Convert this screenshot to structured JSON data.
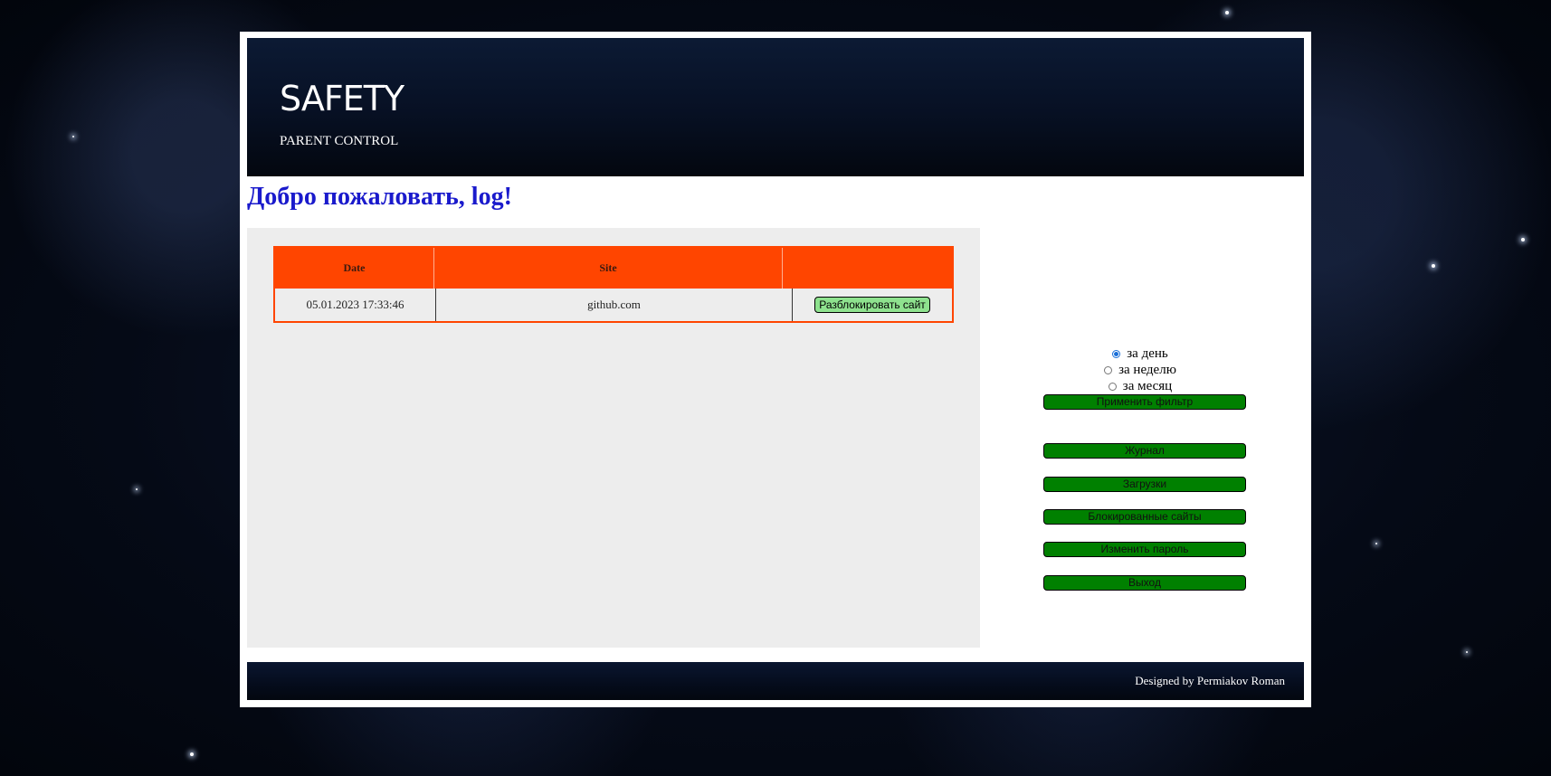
{
  "header": {
    "title": "SAFETY",
    "subtitle": "PARENT CONTROL"
  },
  "welcome": "Добро пожаловать, log!",
  "table": {
    "columns": [
      "Date",
      "Site",
      ""
    ],
    "rows": [
      {
        "date": "05.01.2023 17:33:46",
        "site": "github.com",
        "action_label": "Разблокировать сайт"
      }
    ]
  },
  "filters": {
    "options": [
      {
        "label": "за день",
        "checked": true
      },
      {
        "label": "за неделю",
        "checked": false
      },
      {
        "label": "за месяц",
        "checked": false
      }
    ],
    "apply_label": "Применить фильтр"
  },
  "menu": {
    "journal": "Журнал",
    "downloads": "Загрузки",
    "blocked_sites": "Блокированные сайты",
    "change_password": "Изменить пароль",
    "logout": "Выход"
  },
  "footer": {
    "credit": "Designed by Permiakov Roman"
  },
  "colors": {
    "table_header": "#ff4500",
    "button_green": "#008000",
    "unblock_button": "#8ee28e",
    "welcome_text": "#1a1acc"
  }
}
